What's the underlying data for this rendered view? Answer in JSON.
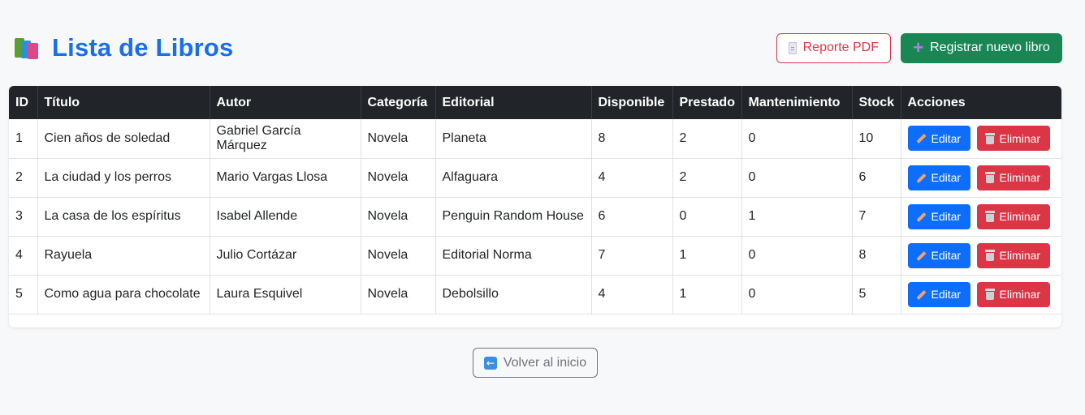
{
  "header": {
    "title": "Lista de Libros",
    "pdf_label": "Reporte PDF",
    "new_label": "Registrar nuevo libro"
  },
  "table": {
    "columns": [
      "ID",
      "Título",
      "Autor",
      "Categoría",
      "Editorial",
      "Disponible",
      "Prestado",
      "Mantenimiento",
      "Stock",
      "Acciones"
    ],
    "rows": [
      [
        "1",
        "Cien años de soledad",
        "Gabriel García Márquez",
        "Novela",
        "Planeta",
        "8",
        "2",
        "0",
        "10"
      ],
      [
        "2",
        "La ciudad y los perros",
        "Mario Vargas Llosa",
        "Novela",
        "Alfaguara",
        "4",
        "2",
        "0",
        "6"
      ],
      [
        "3",
        "La casa de los espíritus",
        "Isabel Allende",
        "Novela",
        "Penguin Random House",
        "6",
        "0",
        "1",
        "7"
      ],
      [
        "4",
        "Rayuela",
        "Julio Cortázar",
        "Novela",
        "Editorial Norma",
        "7",
        "1",
        "0",
        "8"
      ],
      [
        "5",
        "Como agua para chocolate",
        "Laura Esquivel",
        "Novela",
        "Debolsillo",
        "4",
        "1",
        "0",
        "5"
      ]
    ],
    "edit_label": "Editar",
    "delete_label": "Eliminar"
  },
  "footer": {
    "back_label": "Volver al inicio"
  },
  "colors": {
    "primary": "#0d6efd",
    "title": "#1a6fe8",
    "danger": "#dc3545",
    "success": "#198754",
    "header_bg": "#212529"
  }
}
